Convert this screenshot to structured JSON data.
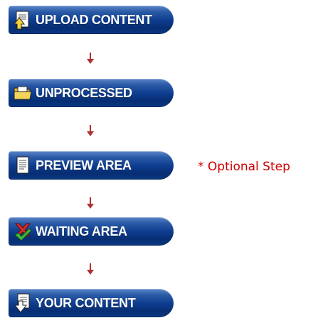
{
  "steps": [
    {
      "label": "UPLOAD CONTENT",
      "icon": "upload-document-icon"
    },
    {
      "label": "UNPROCESSED",
      "icon": "folder-icon"
    },
    {
      "label": "PREVIEW AREA",
      "icon": "document-icon"
    },
    {
      "label": "WAITING AREA",
      "icon": "cross-check-icon"
    },
    {
      "label": "YOUR CONTENT",
      "icon": "download-document-icon"
    }
  ],
  "optional_note": "* Optional Step",
  "colors": {
    "button_dark": "#072e73",
    "button_light": "#5b86c8",
    "arrow": "#b03030",
    "note": "#cc0000"
  }
}
